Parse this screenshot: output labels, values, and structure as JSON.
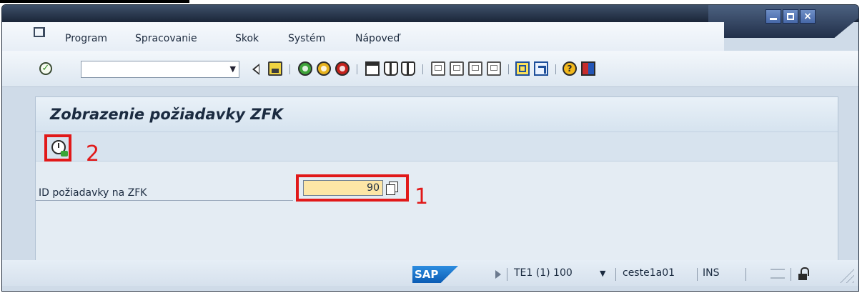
{
  "menu": {
    "items": [
      {
        "label": "Program"
      },
      {
        "label": "Spracovanie"
      },
      {
        "label": "Skok"
      },
      {
        "label": "Systém"
      },
      {
        "label": "Nápoveď"
      }
    ]
  },
  "toolbar": {
    "command_value": "",
    "icons": [
      "enter-icon",
      "back-icon",
      "save-icon",
      "green-back-icon",
      "exit-icon",
      "cancel-icon",
      "print-icon",
      "find-icon",
      "find-next-icon",
      "first-page-icon",
      "previous-page-icon",
      "next-page-icon",
      "last-page-icon",
      "new-session-icon",
      "shortcut-icon",
      "help-icon",
      "layout-icon"
    ]
  },
  "page": {
    "title": "Zobrazenie požiadavky ZFK",
    "field_label": "ID požiadavky na ZFK",
    "field_value": "90"
  },
  "annotations": {
    "marker_1": "1",
    "marker_2": "2",
    "color": "#e11919"
  },
  "statusbar": {
    "logo": "SAP",
    "system": "TE1 (1) 100",
    "user": "ceste1a01",
    "mode": "INS"
  }
}
